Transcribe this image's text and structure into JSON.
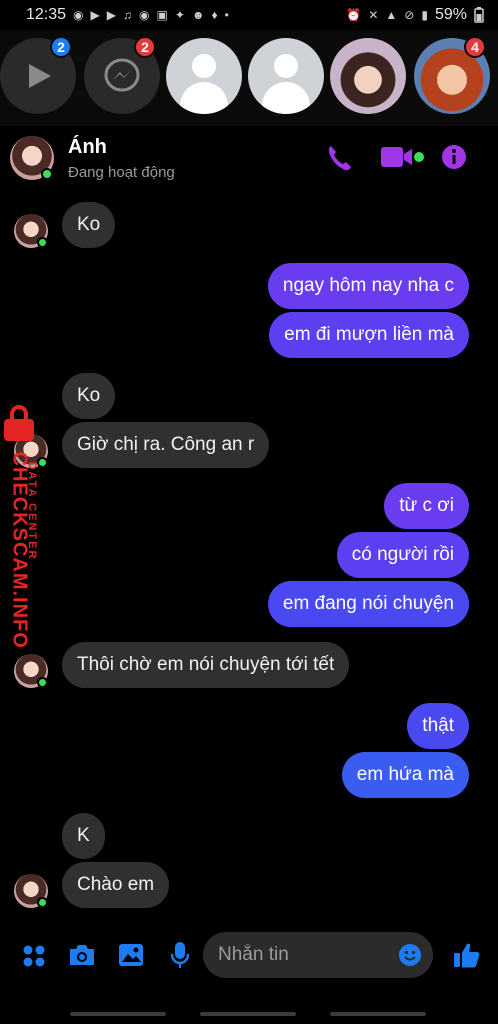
{
  "status_bar": {
    "time": "12:35",
    "battery": "59%",
    "left_icons": [
      "messenger-icon",
      "youtube-icon",
      "youtube-icon",
      "tiktok-icon",
      "pinterest-icon",
      "zalo-icon",
      "twitter-icon",
      "reddit-icon",
      "android-icon",
      "dot-icon"
    ],
    "right_icons": [
      "alarm-icon",
      "mute-icon",
      "wifi-icon",
      "no-disturb-icon",
      "signal-icon"
    ]
  },
  "chat_heads": [
    {
      "name": "video-app",
      "badge": "2",
      "badge_color": "#1d7cf2"
    },
    {
      "name": "messenger",
      "badge": "2",
      "badge_color": "#e53b3b"
    },
    {
      "name": "contact-placeholder-1",
      "badge": ""
    },
    {
      "name": "contact-placeholder-2",
      "badge": ""
    },
    {
      "name": "contact-photo",
      "badge": ""
    },
    {
      "name": "contact-cartoon",
      "badge": "4",
      "badge_color": "#e53b3b"
    }
  ],
  "header": {
    "name": "Ánh",
    "status": "Đang hoạt động",
    "accent": "#a235e8"
  },
  "messages": [
    {
      "side": "in",
      "text": "Ko"
    },
    {
      "side": "out",
      "text": "ngay hôm nay nha c"
    },
    {
      "side": "out",
      "text": "em đi mượn liền mà"
    },
    {
      "side": "in",
      "text": "Ko"
    },
    {
      "side": "in",
      "text": "Giờ chị ra. Công an r"
    },
    {
      "side": "out",
      "text": "từ c ơi"
    },
    {
      "side": "out",
      "text": "có người rồi"
    },
    {
      "side": "out",
      "text": "em đang nói chuyện"
    },
    {
      "side": "in",
      "text": "Thôi chờ em nói chuyện tới tết"
    },
    {
      "side": "out",
      "text": "thật"
    },
    {
      "side": "out",
      "text": "em hứa mà"
    },
    {
      "side": "in",
      "text": "K"
    },
    {
      "side": "in",
      "text": "Chào em"
    }
  ],
  "watermark": {
    "main": "CHECKSCAM.INFO",
    "sub": "DATA CENTER",
    "color": "#e52424"
  },
  "composer": {
    "placeholder": "Nhắn tin",
    "icons": [
      "apps-icon",
      "camera-icon",
      "gallery-icon",
      "microphone-icon",
      "emoji-icon",
      "thumbs-up-icon"
    ],
    "accent": "#1d7cf2"
  }
}
